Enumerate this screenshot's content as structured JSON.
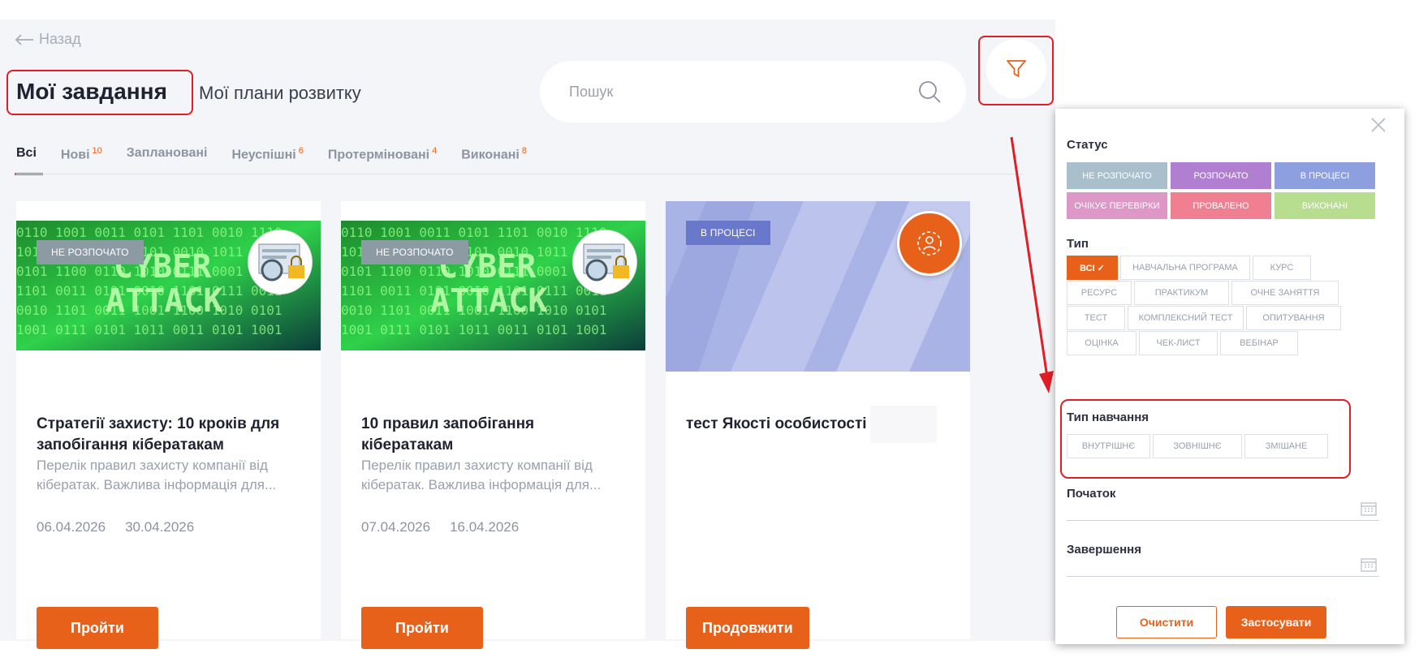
{
  "nav": {
    "back_label": "Назад"
  },
  "header": {
    "title": "Мої завдання",
    "subtitle": "Мої плани розвитку"
  },
  "search": {
    "placeholder": "Пошук"
  },
  "tabs": [
    {
      "label": "Всі",
      "count": ""
    },
    {
      "label": "Нові",
      "count": "10"
    },
    {
      "label": "Заплановані",
      "count": ""
    },
    {
      "label": "Неуспішні",
      "count": "6"
    },
    {
      "label": "Протерміновані",
      "count": "4"
    },
    {
      "label": "Виконані",
      "count": "8"
    }
  ],
  "cards": [
    {
      "badge": "НЕ РОЗПОЧАТО",
      "title": "Стратегії захисту: 10 кроків для запобігання кібератакам",
      "description": "Перелік правил захисту компанії від кібератак. Важлива інформація для...",
      "start_date": "06.04.2026",
      "end_date": "30.04.2026",
      "button": "Пройти"
    },
    {
      "badge": "НЕ РОЗПОЧАТО",
      "title": "10 правил запобігання кібератакам",
      "description": "Перелік правил захисту компанії від кібератак. Важлива інформація для...",
      "start_date": "07.04.2026",
      "end_date": "16.04.2026",
      "button": "Пройти"
    },
    {
      "badge": "В ПРОЦЕСІ",
      "title": "тест Якості особистості",
      "button": "Продовжити"
    }
  ],
  "filter_panel": {
    "status_label": "Статус",
    "statuses": [
      {
        "label": "НЕ РОЗПОЧАТО",
        "color": "#a9bfcb"
      },
      {
        "label": "РОЗПОЧАТО",
        "color": "#b07fd1"
      },
      {
        "label": "В ПРОЦЕСІ",
        "color": "#8e9fe0"
      },
      {
        "label": "ОЧІКУЄ ПЕРЕВІРКИ",
        "color": "#dd98c8"
      },
      {
        "label": "ПРОВАЛЕНО",
        "color": "#f07f92"
      },
      {
        "label": "ВИКОНАНІ",
        "color": "#b7dd8e"
      }
    ],
    "type_label": "Тип",
    "types": [
      "ВСІ ✓",
      "НАВЧАЛЬНА ПРОГРАМА",
      "КУРС",
      "РЕСУРС",
      "ПРАКТИКУМ",
      "ОЧНЕ ЗАНЯТТЯ",
      "ТЕСТ",
      "КОМПЛЕКСНИЙ ТЕСТ",
      "ОПИТУВАННЯ",
      "ОЦІНКА",
      "ЧЕК-ЛИСТ",
      "ВЕБІНАР"
    ],
    "learning_type_label": "Тип навчання",
    "learning_types": [
      "ВНУТРІШНЄ",
      "ЗОВНІШНЄ",
      "ЗМІШАНЕ"
    ],
    "start_label": "Початок",
    "end_label": "Завершення",
    "clear_button": "Очистити",
    "apply_button": "Застосувати"
  },
  "colors": {
    "accent": "#e8611a",
    "highlight": "#e01e26"
  }
}
